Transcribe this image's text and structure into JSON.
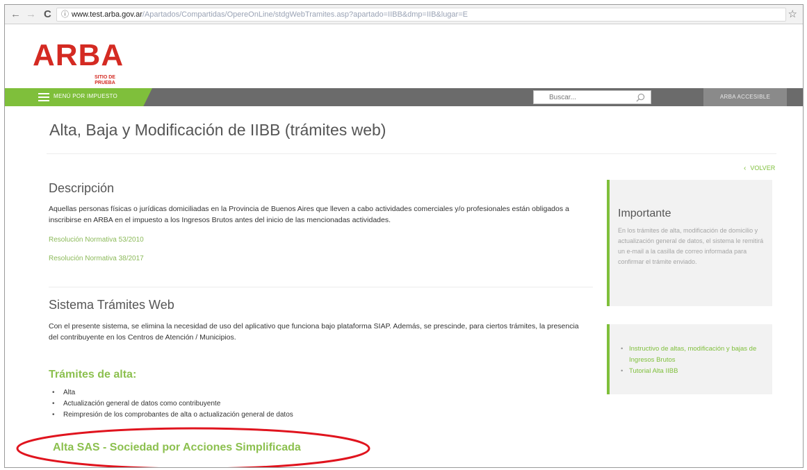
{
  "browser": {
    "url_host": "www.test.arba.gov.ar",
    "url_path": "/Apartados/Compartidas/OpereOnLine/stdgWebTramites.asp?apartado=IIBB&dmp=IIB&lugar=E"
  },
  "header": {
    "logo_text": "ARBA",
    "logo_subtext": "SITIO DE PRUEBA",
    "menu_label": "MENÚ POR IMPUESTO",
    "search_placeholder": "Buscar...",
    "accesible_label": "ARBA ACCESIBLE"
  },
  "main": {
    "title": "Alta, Baja y Modificación de IIBB (trámites web)",
    "volver_label": "VOLVER",
    "descripcion": {
      "heading": "Descripción",
      "text": "Aquellas personas físicas o jurídicas domiciliadas en la Provincia de Buenos Aires que lleven a cabo actividades comerciales y/o profesionales están obligados a inscribirse en ARBA en el impuesto a los Ingresos Brutos antes del inicio de las mencionadas actividades.",
      "links": [
        "Resolución Normativa 53/2010",
        "Resolución Normativa 38/2017"
      ]
    },
    "sistema": {
      "heading": "Sistema Trámites Web",
      "text": "Con el presente sistema, se elimina la necesidad de uso del aplicativo que funciona bajo plataforma SIAP. Además, se prescinde, para ciertos trámites, la presencia del contribuyente en los Centros de Atención / Municipios."
    },
    "tramites_alta": {
      "heading": "Trámites de alta:",
      "items": [
        "Alta",
        "Actualización general de datos como contribuyente",
        "Reimpresión de los comprobantes de alta o actualización general de datos"
      ]
    },
    "sas_heading": "Alta SAS - Sociedad por Acciones Simplificada"
  },
  "sidebar": {
    "importante": {
      "title": "Importante",
      "text": "En los trámites de alta, modificación de domicilio y actualización general de datos, el sistema le remitirá un e-mail a la casilla de correo informada para confirmar el trámite enviado."
    },
    "links": [
      "Instructivo de altas, modificación y bajas de Ingresos Brutos",
      "Tutorial Alta IIBB"
    ]
  },
  "colors": {
    "brand_red": "#d42a22",
    "brand_green": "#7fbf3b",
    "navbar_gray": "#6b6b6b",
    "annotation_red": "#e0141e"
  }
}
